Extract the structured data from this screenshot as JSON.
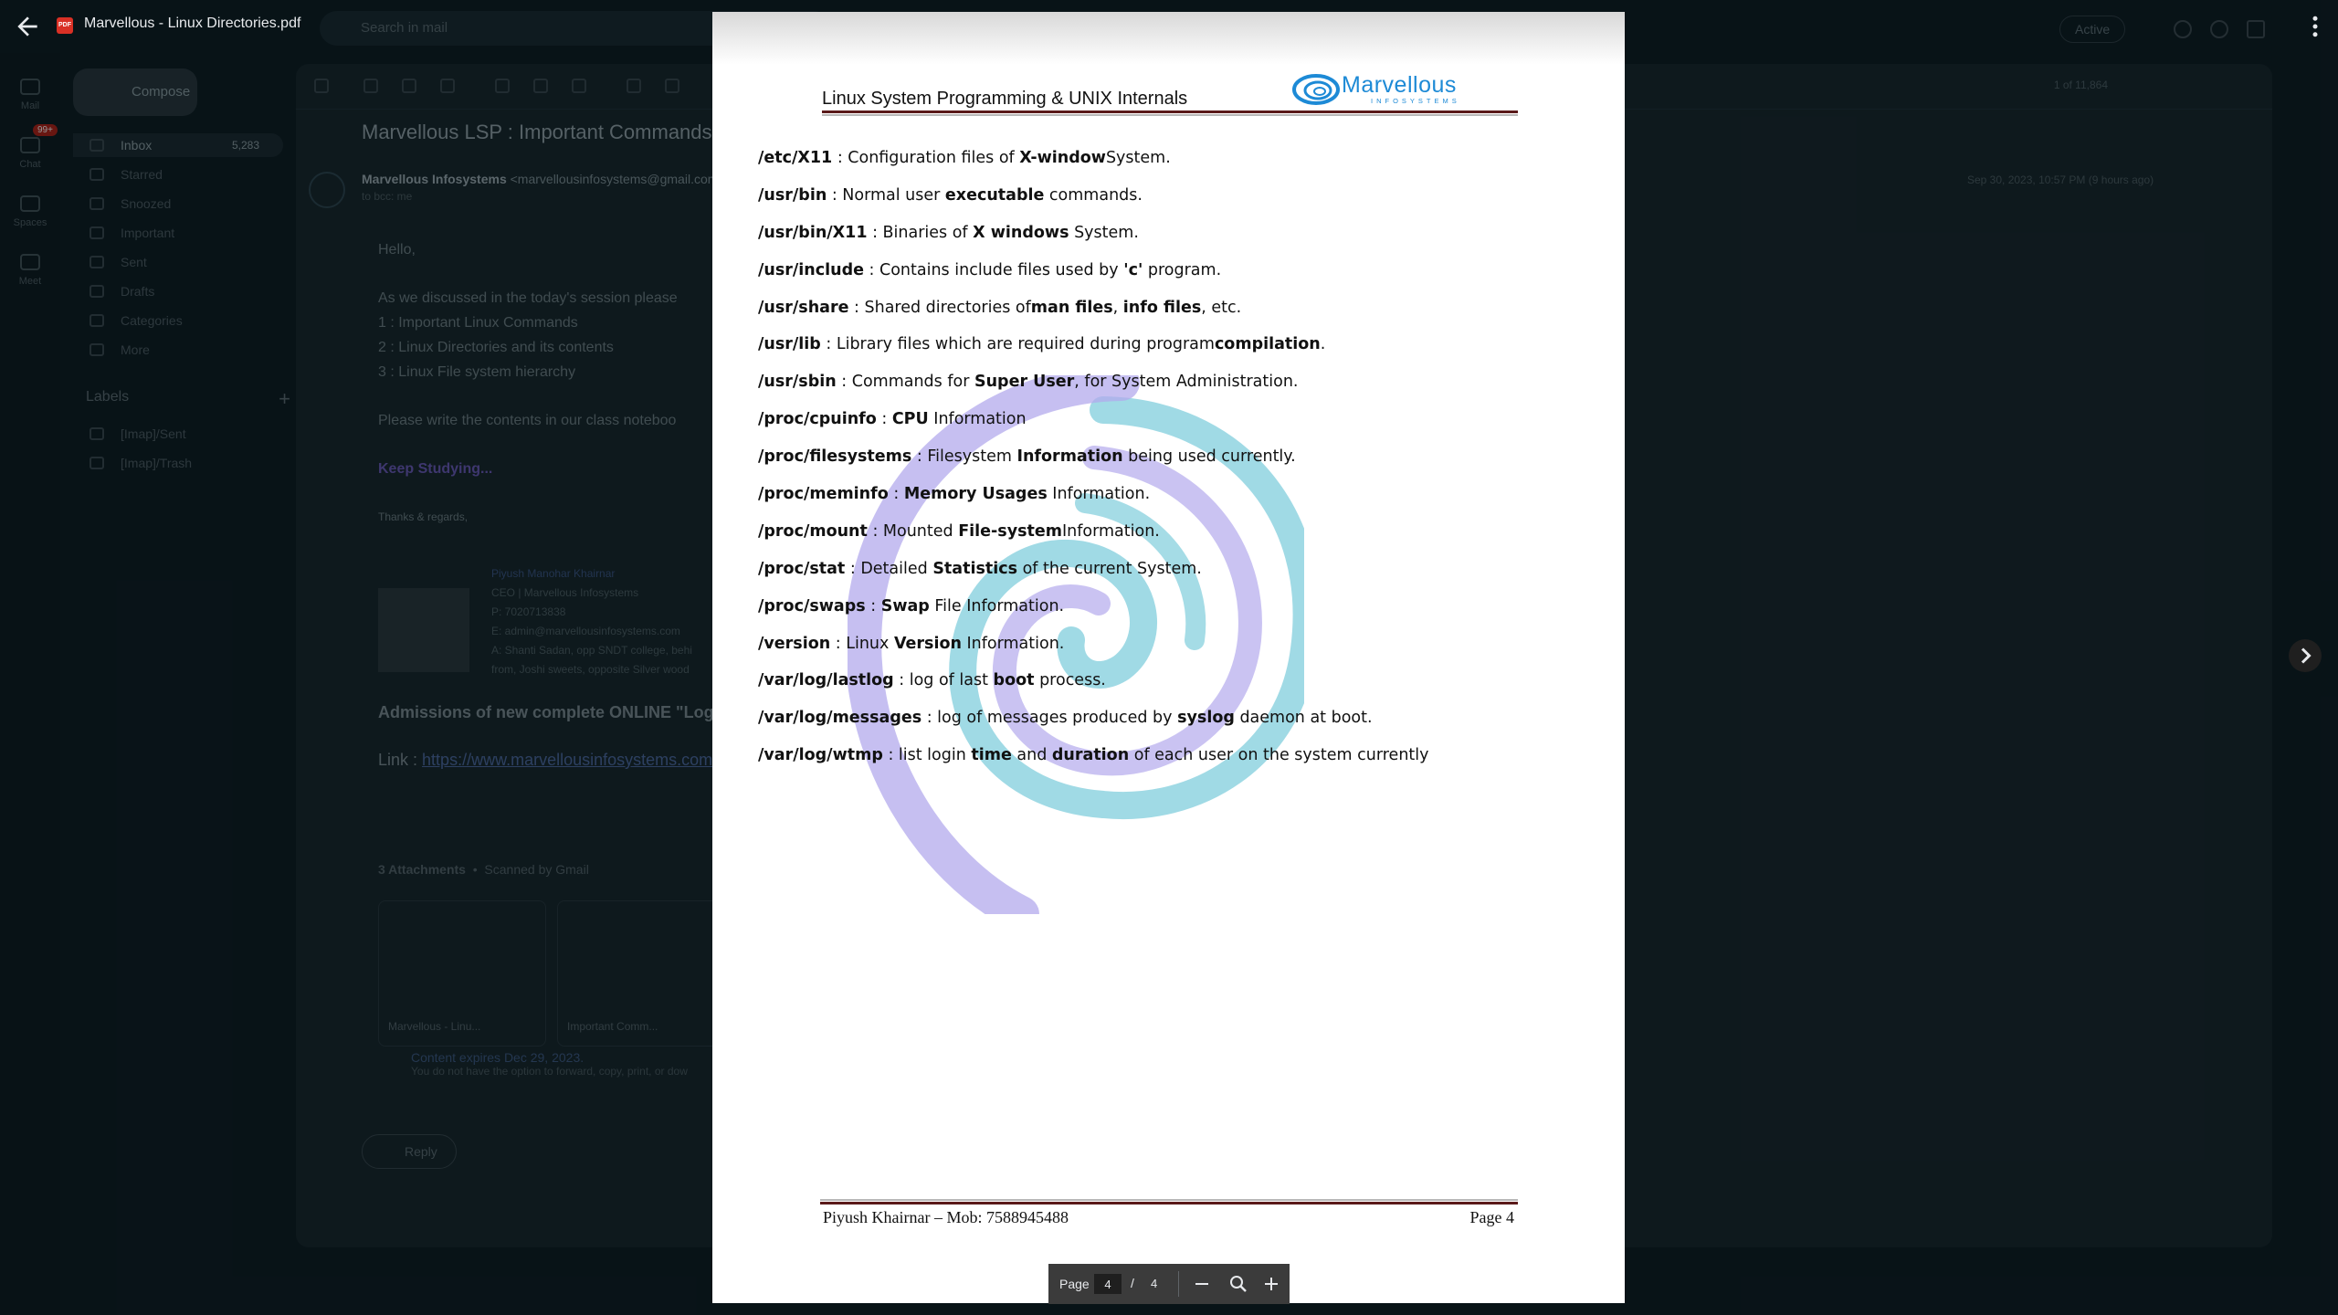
{
  "viewer": {
    "title": "Marvellous - Linux Directories.pdf",
    "pdf_badge": "PDF"
  },
  "gmail": {
    "search_placeholder": "Search in mail",
    "status": "Active",
    "mail_badge": "99+",
    "rail": [
      "Mail",
      "Chat",
      "Spaces",
      "Meet"
    ],
    "compose": "Compose",
    "sidebar": [
      {
        "label": "Inbox",
        "count": "5,283"
      },
      {
        "label": "Starred",
        "count": ""
      },
      {
        "label": "Snoozed",
        "count": ""
      },
      {
        "label": "Important",
        "count": ""
      },
      {
        "label": "Sent",
        "count": ""
      },
      {
        "label": "Drafts",
        "count": ""
      },
      {
        "label": "Categories",
        "count": ""
      },
      {
        "label": "More",
        "count": ""
      }
    ],
    "labels_title": "Labels",
    "labels": [
      "[Imap]/Sent",
      "[Imap]/Trash"
    ],
    "pager": "1 of 11,864",
    "subject": "Marvellous LSP : Important Commands",
    "sender_name": "Marvellous Infosystems",
    "sender_email": "<marvellousinfosystems@gmail.com>",
    "to": "to bcc: me",
    "date": "Sep 30, 2023, 10:57 PM (9 hours ago)",
    "body": {
      "greeting": "Hello,",
      "intro": "As we discussed in the today's session please",
      "items": [
        "1 : Important Linux Commands",
        "2 : Linux Directories and its contents",
        "3 : Linux File system hierarchy"
      ],
      "request": "Please write the contents in our class noteboo",
      "keep": "Keep Studying...",
      "regards": "Thanks & regards,"
    },
    "signature": {
      "name": "Piyush Manohar Khairnar",
      "role": "CEO | Marvellous Infosystems",
      "phone": "P: 7020713838",
      "email": "E: admin@marvellousinfosystems.com",
      "address1": "A: Shanti Sadan, opp SNDT college, behi",
      "address2": "from, Joshi sweets, opposite Silver wood"
    },
    "admissions": "Admissions of new complete ONLINE \"Log",
    "link_label": "Link :",
    "link_url": "https://www.marvellousinfosystems.com",
    "attachments_title": "3 Attachments",
    "scanned": "Scanned by Gmail",
    "attachments": [
      "Marvellous - Linu...",
      "Important Comm..."
    ],
    "expire_title": "Content expires Dec 29, 2023.",
    "expire_note": "You do not have the option to forward, copy, print, or dow",
    "reply": "Reply"
  },
  "pdf": {
    "header": "Linux System Programming & UNIX Internals",
    "logo_name": "Marvellous",
    "logo_sub": "INFOSYSTEMS",
    "entries": [
      [
        {
          "t": "/etc/X11",
          "b": true
        },
        {
          "t": " : Configuration files of "
        },
        {
          "t": "X-window",
          "b": true
        },
        {
          "t": "System."
        }
      ],
      [
        {
          "t": "/usr/bin",
          "b": true
        },
        {
          "t": " : Normal user "
        },
        {
          "t": "executable",
          "b": true
        },
        {
          "t": " commands."
        }
      ],
      [
        {
          "t": "/usr/bin/X11",
          "b": true
        },
        {
          "t": " : Binaries of "
        },
        {
          "t": "X windows",
          "b": true
        },
        {
          "t": " System."
        }
      ],
      [
        {
          "t": "/usr/include",
          "b": true
        },
        {
          "t": " : Contains include files used by "
        },
        {
          "t": "'c'",
          "b": true
        },
        {
          "t": " program."
        }
      ],
      [
        {
          "t": "/usr/share",
          "b": true
        },
        {
          "t": " : Shared directories of"
        },
        {
          "t": "man files",
          "b": true
        },
        {
          "t": ", "
        },
        {
          "t": "info files",
          "b": true
        },
        {
          "t": ", etc."
        }
      ],
      [
        {
          "t": "/usr/lib",
          "b": true
        },
        {
          "t": " : Library files which are required during program"
        },
        {
          "t": "compilation",
          "b": true
        },
        {
          "t": "."
        }
      ],
      [
        {
          "t": "/usr/sbin",
          "b": true
        },
        {
          "t": " : Commands for "
        },
        {
          "t": "Super User",
          "b": true
        },
        {
          "t": ", for System Administration."
        }
      ],
      [
        {
          "t": "/proc/cpuinfo",
          "b": true
        },
        {
          "t": " : "
        },
        {
          "t": "CPU",
          "b": true
        },
        {
          "t": " Information"
        }
      ],
      [
        {
          "t": "/proc/filesystems",
          "b": true
        },
        {
          "t": " : Filesystem "
        },
        {
          "t": "Information",
          "b": true
        },
        {
          "t": " being used currently."
        }
      ],
      [
        {
          "t": "/proc/meminfo",
          "b": true
        },
        {
          "t": " : "
        },
        {
          "t": "Memory Usages",
          "b": true
        },
        {
          "t": " Information."
        }
      ],
      [
        {
          "t": "/proc/mount",
          "b": true
        },
        {
          "t": " : Mounted "
        },
        {
          "t": "File-system",
          "b": true
        },
        {
          "t": "Information."
        }
      ],
      [
        {
          "t": "/proc/stat",
          "b": true
        },
        {
          "t": " : Detailed "
        },
        {
          "t": "Statistics",
          "b": true
        },
        {
          "t": " of the current System."
        }
      ],
      [
        {
          "t": "/proc/swaps",
          "b": true
        },
        {
          "t": " : "
        },
        {
          "t": "Swap",
          "b": true
        },
        {
          "t": " File Information."
        }
      ],
      [
        {
          "t": "/version",
          "b": true
        },
        {
          "t": " : Linux "
        },
        {
          "t": "Version",
          "b": true
        },
        {
          "t": " Information."
        }
      ],
      [
        {
          "t": "/var/log/lastlog",
          "b": true
        },
        {
          "t": " : log of last "
        },
        {
          "t": "boot",
          "b": true
        },
        {
          "t": " process."
        }
      ],
      [
        {
          "t": "/var/log/messages",
          "b": true
        },
        {
          "t": " : log of messages produced by "
        },
        {
          "t": "syslog",
          "b": true
        },
        {
          "t": " daemon at boot."
        }
      ],
      [
        {
          "t": "/var/log/wtmp",
          "b": true
        },
        {
          "t": " : list login "
        },
        {
          "t": "time",
          "b": true
        },
        {
          "t": " and "
        },
        {
          "t": "duration",
          "b": true
        },
        {
          "t": " of each user on the system currently"
        }
      ]
    ],
    "footer_left": "Piyush Khairnar – Mob: 7588945488",
    "footer_right": "Page 4"
  },
  "toolbar": {
    "page_label": "Page",
    "current_page": "4",
    "separator": "/",
    "total_pages": "4"
  },
  "colors": {
    "rule_dark": "#5a1a1a",
    "swirl_blue": "#8fd3e0",
    "swirl_purple": "#b3a9ec",
    "logo_blue": "#1d8ad6"
  },
  "icons": [
    "back-arrow-icon",
    "pdf-icon",
    "more-vert-icon",
    "chevron-right-icon",
    "zoom-out-icon",
    "search-zoom-icon",
    "zoom-in-icon"
  ]
}
